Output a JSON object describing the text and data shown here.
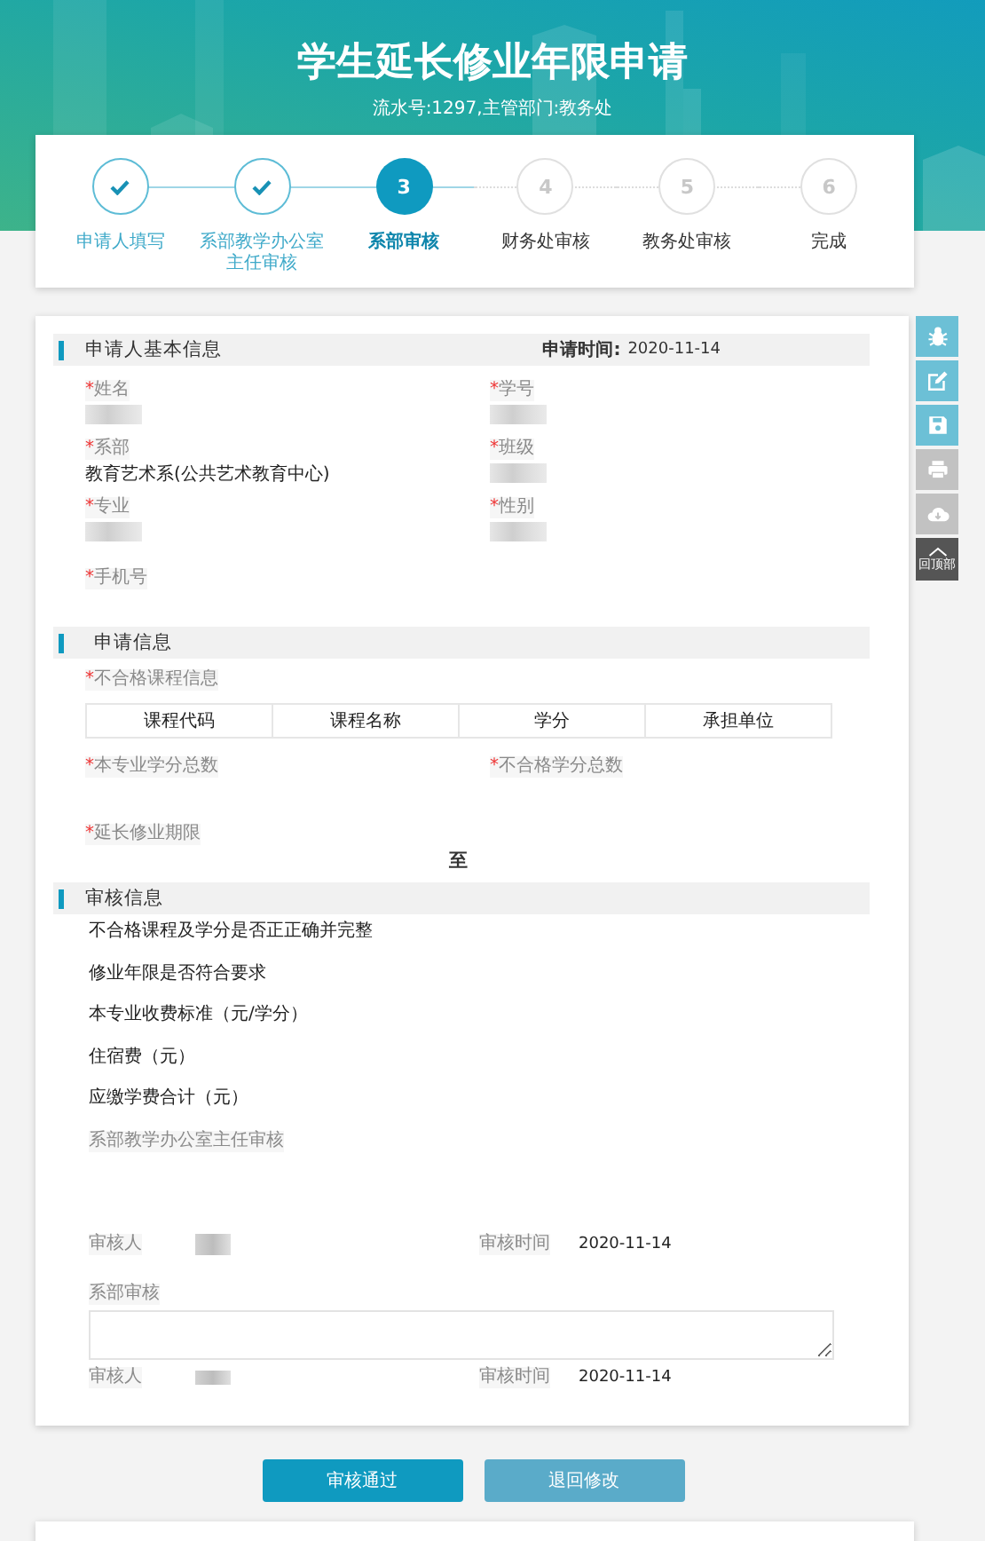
{
  "header": {
    "title": "学生延长修业年限申请",
    "subtitle": "流水号:1297,主管部门:教务处"
  },
  "steps": [
    {
      "label": "申请人填写",
      "done": true,
      "selected": false
    },
    {
      "label": "系部教学办公室主任审核",
      "done": true,
      "selected": false
    },
    {
      "number": "3",
      "label": "系部审核",
      "done": false,
      "selected": true
    },
    {
      "number": "4",
      "label": "财务处审核",
      "done": false,
      "selected": false
    },
    {
      "number": "5",
      "label": "教务处审核",
      "done": false,
      "selected": false
    },
    {
      "number": "6",
      "label": "完成",
      "done": false,
      "selected": false
    }
  ],
  "applicant": {
    "title": "申请人基本信息",
    "date_label": "申请时间:",
    "date": "2020-11-14",
    "fields": [
      {
        "required_mark": "*",
        "label": "姓名",
        "redacted": true
      },
      {
        "required_mark": "*",
        "label": "学号",
        "redacted": true
      },
      {
        "required_mark": "*",
        "label": "系部",
        "redacted": false,
        "value": "教育艺术系(公共艺术教育中心)"
      },
      {
        "required_mark": "*",
        "label": "班级",
        "redacted": true
      },
      {
        "required_mark": "*",
        "label": "专业",
        "redacted": true
      },
      {
        "required_mark": "*",
        "label": "性别",
        "redacted": true
      },
      {
        "required_mark": "*",
        "label": "手机号",
        "redacted": false
      }
    ]
  },
  "application": {
    "title": "申请信息",
    "course_required_mark": "*",
    "course_label": "不合格课程信息",
    "table": {
      "columns": [
        "课程代码",
        "课程名称",
        "学分",
        "承担单位"
      ]
    },
    "fields": [
      {
        "required_mark": "*",
        "label": "本专业学分总数"
      },
      {
        "required_mark": "*",
        "label": "不合格学分总数"
      }
    ],
    "period_required_mark": "*",
    "period_label": "延长修业期限",
    "period_separator": "至"
  },
  "review": {
    "title": "审核信息",
    "items": [
      "不合格课程及学分是否正正确并完整",
      "修业年限是否符合要求",
      "本专业收费标准（元/学分）",
      "住宿费（元）",
      "应缴学费合计（元）"
    ],
    "director_label": "系部教学办公室主任审核",
    "director_sign": {
      "reviewer_label": "审核人",
      "reviewer_redacted": true,
      "time_label": "审核时间",
      "time": "2020-11-14"
    },
    "dept_label": "系部审核",
    "dept_sign": {
      "reviewer_label": "审核人",
      "reviewer_redacted": true,
      "time_label": "审核时间",
      "time": "2020-11-14"
    }
  },
  "toolbar": [
    {
      "kind": "bug",
      "enabled": true
    },
    {
      "kind": "edit",
      "enabled": true
    },
    {
      "kind": "save",
      "enabled": true
    },
    {
      "kind": "print",
      "enabled": false
    },
    {
      "kind": "download",
      "enabled": false
    },
    {
      "kind": "top",
      "enabled": true,
      "label": "回顶部"
    }
  ],
  "buttons": [
    {
      "label": "审核通过",
      "kind": "primary"
    },
    {
      "label": "退回修改",
      "kind": "secondary"
    }
  ]
}
